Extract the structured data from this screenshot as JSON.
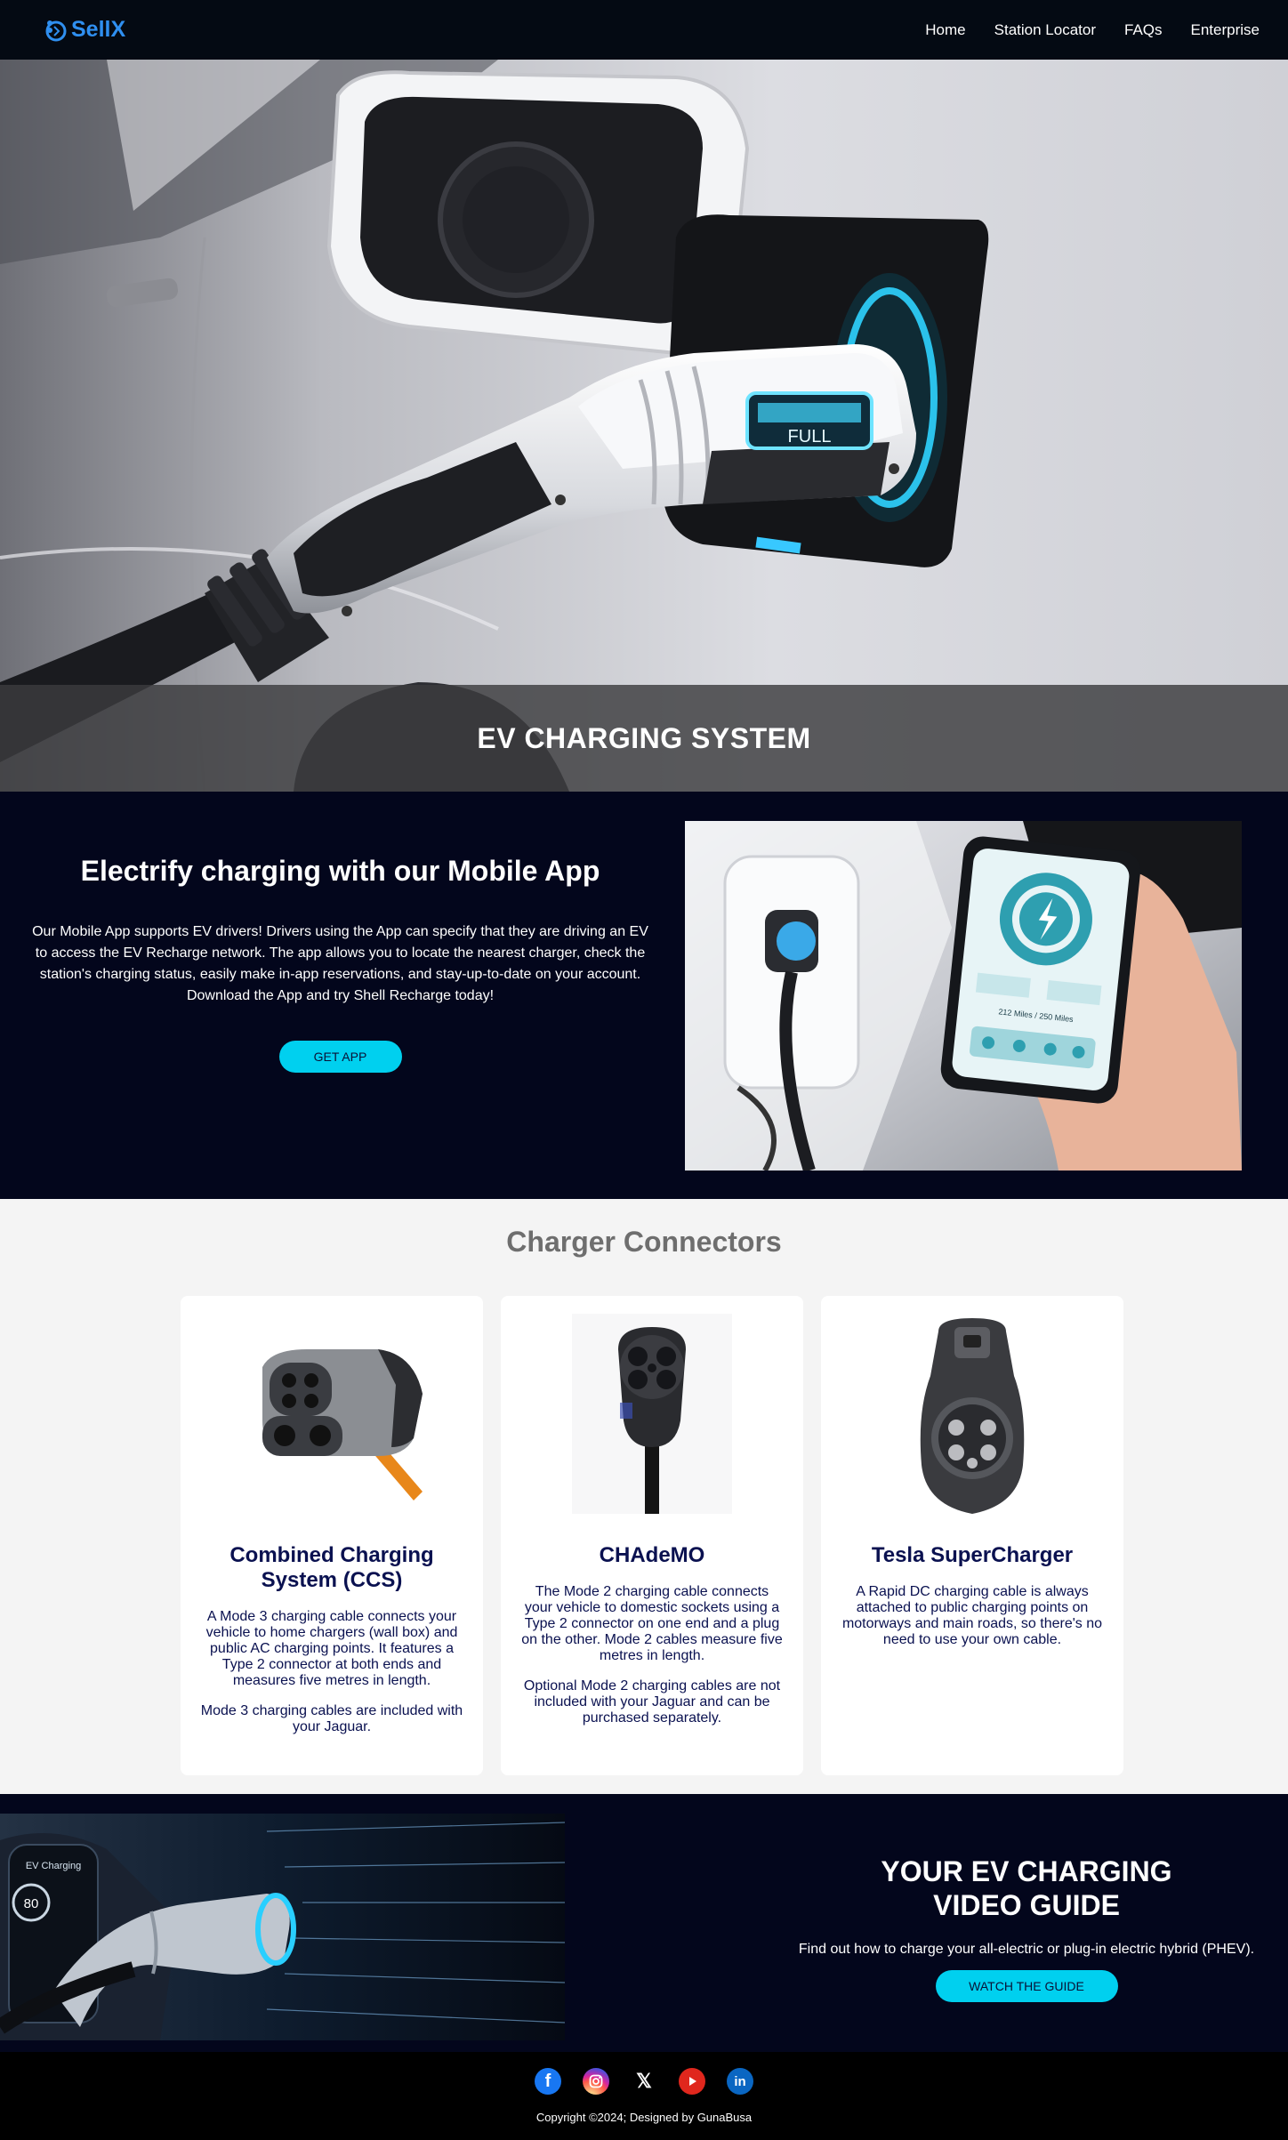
{
  "nav": {
    "brand": "SellX",
    "links": [
      "Home",
      "Station Locator",
      "FAQs",
      "Enterprise"
    ]
  },
  "hero": {
    "title": "EV CHARGING SYSTEM",
    "plug_label": "FULL"
  },
  "app": {
    "heading": "Electrify charging with our Mobile App",
    "description": "Our Mobile App supports EV drivers! Drivers using the App can specify that they are driving an EV to access the EV Recharge network. The app allows you to locate the nearest charger, check the station's charging status, easily make in-app reservations, and stay-up-to-date on your account. Download the App and try Shell Recharge today!",
    "button": "GET APP",
    "phone_miles": "212 Miles / 250 Miles"
  },
  "connectors": {
    "heading": "Charger Connectors",
    "cards": [
      {
        "title": "Combined Charging System (CCS)",
        "desc": "A Mode 3 charging cable connects your vehicle to home chargers (wall box) and public AC charging points. It features a Type 2 connector at both ends and measures five metres in length.",
        "desc2": "Mode 3 charging cables are included with your Jaguar."
      },
      {
        "title": "CHAdeMO",
        "desc": "The Mode 2 charging cable connects your vehicle to domestic sockets using a Type 2 connector on one end and a plug on the other. Mode 2 cables measure five metres in length.",
        "desc2": "Optional Mode 2 charging cables are not included with your Jaguar and can be purchased separately."
      },
      {
        "title": "Tesla SuperCharger",
        "desc": "A Rapid DC charging cable is always attached to public charging points on motorways and main roads, so there's no need to use your own cable.",
        "desc2": ""
      }
    ]
  },
  "guide": {
    "heading_line1": "YOUR EV CHARGING",
    "heading_line2": "VIDEO GUIDE",
    "description": "Find out how to charge your all-electric or plug-in electric hybrid (PHEV).",
    "button": "WATCH THE GUIDE",
    "dash_label": "EV Charging",
    "dash_value": "80"
  },
  "footer": {
    "copyright": "Copyright ©2024; Designed by GunaBusa",
    "socials": [
      "facebook",
      "instagram",
      "x",
      "youtube",
      "linkedin"
    ]
  },
  "colors": {
    "nav_bg": "#040a13",
    "brand": "#2f8ff0",
    "dark_section": "#03061c",
    "accent_button": "#00d0ef",
    "card_text": "#0a1150",
    "connectors_heading": "#6e6e6e"
  }
}
